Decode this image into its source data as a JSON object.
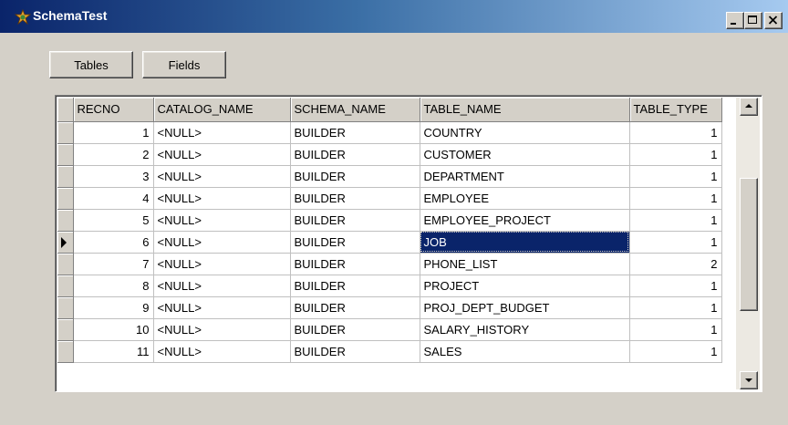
{
  "window": {
    "title": "SchemaTest",
    "icon": "app-icon",
    "caption_buttons": [
      "minimize-icon",
      "maximize-icon",
      "close-icon"
    ]
  },
  "toolbar": {
    "tables_label": "Tables",
    "fields_label": "Fields"
  },
  "grid": {
    "columns": [
      "RECNO",
      "CATALOG_NAME",
      "SCHEMA_NAME",
      "TABLE_NAME",
      "TABLE_TYPE"
    ],
    "rows": [
      [
        "1",
        "<NULL>",
        "BUILDER",
        "COUNTRY",
        "1"
      ],
      [
        "2",
        "<NULL>",
        "BUILDER",
        "CUSTOMER",
        "1"
      ],
      [
        "3",
        "<NULL>",
        "BUILDER",
        "DEPARTMENT",
        "1"
      ],
      [
        "4",
        "<NULL>",
        "BUILDER",
        "EMPLOYEE",
        "1"
      ],
      [
        "5",
        "<NULL>",
        "BUILDER",
        "EMPLOYEE_PROJECT",
        "1"
      ],
      [
        "6",
        "<NULL>",
        "BUILDER",
        "JOB",
        "1"
      ],
      [
        "7",
        "<NULL>",
        "BUILDER",
        "PHONE_LIST",
        "2"
      ],
      [
        "8",
        "<NULL>",
        "BUILDER",
        "PROJECT",
        "1"
      ],
      [
        "9",
        "<NULL>",
        "BUILDER",
        "PROJ_DEPT_BUDGET",
        "1"
      ],
      [
        "10",
        "<NULL>",
        "BUILDER",
        "SALARY_HISTORY",
        "1"
      ],
      [
        "11",
        "<NULL>",
        "BUILDER",
        "SALES",
        "1"
      ]
    ],
    "current_row": 5,
    "selected_column": 3,
    "selection_color": "#0a246a"
  }
}
